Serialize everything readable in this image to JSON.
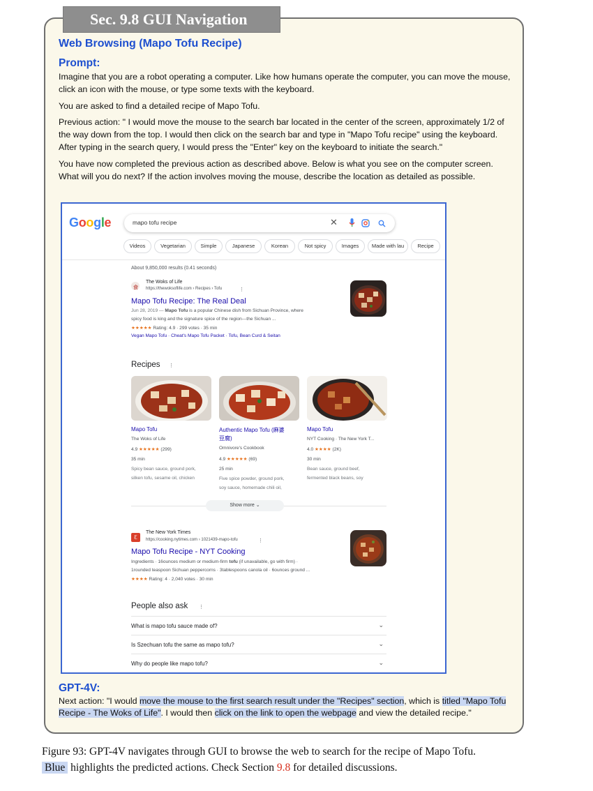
{
  "section_tab": "Sec. 9.8 GUI Navigation",
  "title": "Web Browsing (Mapo Tofu Recipe)",
  "prompt_heading": "Prompt:",
  "prompt_paragraphs": [
    "Imagine that you are a robot operating a computer. Like how humans operate the computer, you can move the mouse, click an icon with the mouse, or type some texts with the keyboard.",
    "You are asked to find a detailed recipe of Mapo Tofu.",
    "Previous action: \" I would move the mouse to the search bar located in the center of the screen, approximately 1/2 of the way down from the top. I would then click on the search bar and type in \"Mapo Tofu recipe\" using the keyboard. After typing in the search query, I would press the \"Enter\" key on the keyboard to initiate the search.\"",
    "You have now completed the previous action as described above. Below is what you see on the computer screen. What will you do next? If the action involves moving the mouse, describe the location as detailed as possible."
  ],
  "screenshot": {
    "logo_letters": [
      {
        "ch": "G",
        "color": "#4285f4"
      },
      {
        "ch": "o",
        "color": "#ea4335"
      },
      {
        "ch": "o",
        "color": "#fbbc05"
      },
      {
        "ch": "g",
        "color": "#4285f4"
      },
      {
        "ch": "l",
        "color": "#34a853"
      },
      {
        "ch": "e",
        "color": "#ea4335"
      }
    ],
    "search_query": "mapo tofu recipe",
    "icons": [
      "close-icon",
      "mic-icon",
      "lens-icon",
      "search-icon"
    ],
    "chips": [
      "Videos",
      "Vegetarian",
      "Simple",
      "Japanese",
      "Korean",
      "Not spicy",
      "Images",
      "Made with lau",
      "Recipe"
    ],
    "results_count": "About 9,850,000 results (0.41 seconds)",
    "result1": {
      "site": "The Woks of Life",
      "url": "https://thewoksoflife.com › Recipes › Tofu",
      "more": "⋮",
      "title": "Mapo Tofu Recipe: The Real Deal",
      "snippet1_date": "Jun 28, 2019 —",
      "snippet1_bold": "Mapo Tofu",
      "snippet1_rest": "is a popular Chinese dish from Sichuan Province, where",
      "snippet2": "spicy food is king and the signature spice of the region---the Sichuan ...",
      "rating_stars": "★★★★★",
      "rating_text": "Rating: 4.9 · 299 votes · 35 min",
      "sitelinks": "Vegan Mapo Tofu · Cheat's Mapo Tofu Packet · Tofu, Bean Curd & Seitan"
    },
    "recipes_heading": "Recipes",
    "recipes_more": "⋮",
    "recipe_cards": [
      {
        "title": "Mapo Tofu",
        "title2": "",
        "source": "The Woks of Life",
        "rating_num": "4.9",
        "stars": "★★★★★",
        "votes": "(299)",
        "time": "35 min",
        "ing1": "Spicy bean sauce, ground pork,",
        "ing2": "silken tofu, sesame oil, chicken"
      },
      {
        "title": "Authentic Mapo Tofu (麻婆",
        "title2": "豆腐)",
        "source": "Omnivore's Cookbook",
        "rating_num": "4.9",
        "stars": "★★★★★",
        "votes": "(69)",
        "time": "25 min",
        "ing1": "Five spice powder, ground pork,",
        "ing2": "soy sauce, homemade chili oil,"
      },
      {
        "title": "Mapo Tofu",
        "title2": "",
        "source": "NYT Cooking · The New York T...",
        "rating_num": "4.0",
        "stars": "★★★★",
        "votes": "(2K)",
        "time": "30 min",
        "ing1": "Bean sauce, ground beef,",
        "ing2": "fermented black beans, soy"
      }
    ],
    "show_more": "Show more",
    "result2": {
      "site": "The New York Times",
      "url": "https://cooking.nytimes.com › 1021439-mapo-tofu",
      "more": "⋮",
      "title": "Mapo Tofu Recipe - NYT Cooking",
      "snippet1_pre": "Ingredients · 16ounces medium or medium-firm",
      "snippet1_bold": "tofu",
      "snippet1_rest": "(if unavailable, go with firm) ·",
      "snippet2": "1rounded teaspoon Sichuan peppercorns · 3tablespoons canola oil · 6ounces ground ...",
      "rating_stars": "★★★★",
      "rating_text": "Rating: 4 · 2,040 votes · 30 min"
    },
    "paa_heading": "People also ask",
    "paa_more": "⋮",
    "paa_questions": [
      "What is mapo tofu sauce made of?",
      "Is Szechuan tofu the same as mapo tofu?",
      "Why do people like mapo tofu?"
    ]
  },
  "gpt_heading": "GPT-4V:",
  "answer": {
    "p1": "Next action: \"I would ",
    "h1": "move the mouse to the first search result under the \"Recipes\" section",
    "p2": ", which is ",
    "h2": "titled \"Mapo Tofu Recipe - The Woks of Life\"",
    "p3": ". I would then ",
    "h3": "click on the link to open the webpage",
    "p4": " and view the detailed recipe.\""
  },
  "caption": {
    "line1": "Figure 93: GPT-4V navigates through GUI to browse the web to search for the recipe of Mapo Tofu.",
    "blue_word": "Blue",
    "mid": " highlights the predicted actions. Check Section ",
    "sec_ref": "9.8",
    "end": " for detailed discussions."
  },
  "colors": {
    "link": "#1a0dab",
    "heading_blue": "#1d4fcf",
    "highlight": "#c9d7f2",
    "panel_bg": "#fbf8ea",
    "ref_red": "#d6301f"
  }
}
